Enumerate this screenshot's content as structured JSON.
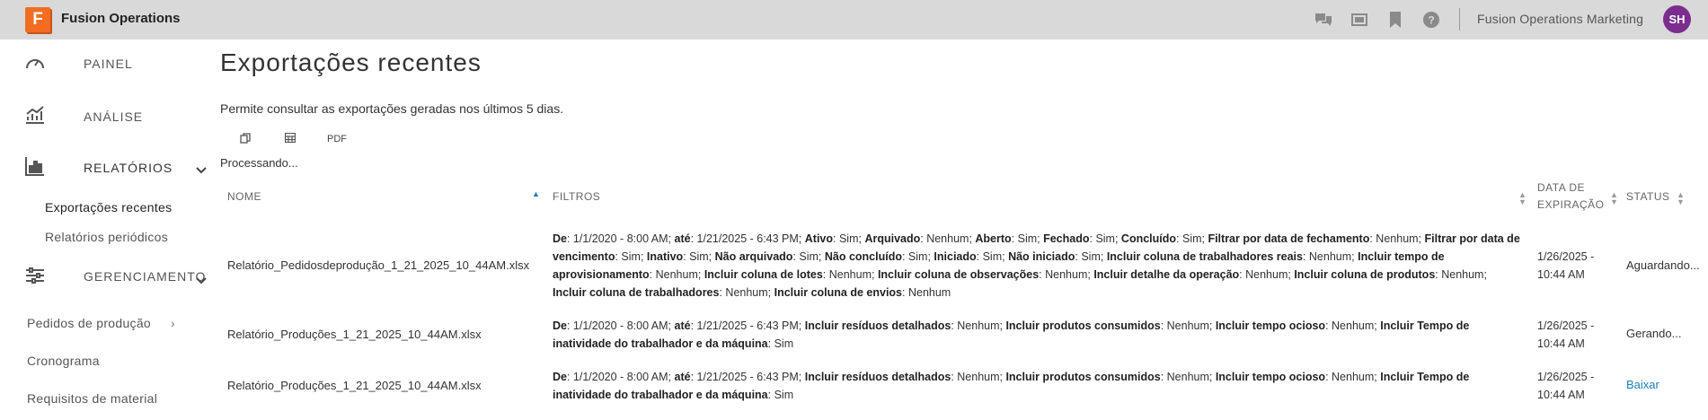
{
  "app": {
    "logo_letter": "F",
    "title": "Fusion Operations",
    "org": "Fusion Operations Marketing",
    "avatar_initials": "SH"
  },
  "topbar_icons": [
    "chat-icon",
    "display-icon",
    "bookmark-icon",
    "help-icon"
  ],
  "sidebar": {
    "items": [
      {
        "label": "PAINEL",
        "icon": "gauge-icon"
      },
      {
        "label": "ANÁLISE",
        "icon": "chart-icon"
      },
      {
        "label": "RELATÓRIOS",
        "icon": "bar-chart-icon"
      },
      {
        "label": "GERENCIAMENTO",
        "icon": "sliders-icon"
      }
    ],
    "sub_items": [
      "Exportações recentes",
      "Relatórios periódicos"
    ],
    "plain_items": [
      "Pedidos de produção",
      "Cronograma",
      "Requisitos de material"
    ]
  },
  "main": {
    "title": "Exportações recentes",
    "description": "Permite consultar as exportações geradas nos últimos 5 dias.",
    "export_buttons": {
      "pdf": "PDF"
    },
    "processing": "Processando..."
  },
  "table": {
    "headers": {
      "name": "NOME",
      "filters": "FILTROS",
      "expiry_line1": "DATA DE",
      "expiry_line2": "EXPIRAÇÃO",
      "status": "STATUS"
    },
    "rows": [
      {
        "name": "Relatório_Pedidosdeprodução_1_21_2025_10_44AM.xlsx",
        "filters": [
          [
            "De",
            "1/1/2020 - 8:00 AM"
          ],
          [
            "até",
            "1/21/2025 - 6:43 PM"
          ],
          [
            "Ativo",
            "Sim"
          ],
          [
            "Arquivado",
            "Nenhum"
          ],
          [
            "Aberto",
            "Sim"
          ],
          [
            "Fechado",
            "Sim"
          ],
          [
            "Concluído",
            "Sim"
          ],
          [
            "Filtrar por data de fechamento",
            "Nenhum"
          ],
          [
            "Filtrar por data de vencimento",
            "Sim"
          ],
          [
            "Inativo",
            "Sim"
          ],
          [
            "Não arquivado",
            "Sim"
          ],
          [
            "Não concluído",
            "Sim"
          ],
          [
            "Iniciado",
            "Sim"
          ],
          [
            "Não iniciado",
            "Sim"
          ],
          [
            "Incluir coluna de trabalhadores reais",
            "Nenhum"
          ],
          [
            "Incluir tempo de aprovisionamento",
            "Nenhum"
          ],
          [
            "Incluir coluna de lotes",
            "Nenhum"
          ],
          [
            "Incluir coluna de observações",
            "Nenhum"
          ],
          [
            "Incluir detalhe da operação",
            "Nenhum"
          ],
          [
            "Incluir coluna de produtos",
            "Nenhum"
          ],
          [
            "Incluir coluna de trabalhadores",
            "Nenhum"
          ],
          [
            "Incluir coluna de envios",
            "Nenhum"
          ]
        ],
        "expiry_date": "1/26/2025 -",
        "expiry_time": "10:44 AM",
        "status": "Aguardando..."
      },
      {
        "name": "Relatório_Produções_1_21_2025_10_44AM.xlsx",
        "filters": [
          [
            "De",
            "1/1/2020 - 8:00 AM"
          ],
          [
            "até",
            "1/21/2025 - 6:43 PM"
          ],
          [
            "Incluir resíduos detalhados",
            "Nenhum"
          ],
          [
            "Incluir produtos consumidos",
            "Nenhum"
          ],
          [
            "Incluir tempo ocioso",
            "Nenhum"
          ],
          [
            "Incluir Tempo de inatividade do trabalhador e da máquina",
            "Sim"
          ]
        ],
        "expiry_date": "1/26/2025 -",
        "expiry_time": "10:44 AM",
        "status": "Gerando..."
      },
      {
        "name": "Relatório_Produções_1_21_2025_10_44AM.xlsx",
        "filters": [
          [
            "De",
            "1/1/2020 - 8:00 AM"
          ],
          [
            "até",
            "1/21/2025 - 6:43 PM"
          ],
          [
            "Incluir resíduos detalhados",
            "Nenhum"
          ],
          [
            "Incluir produtos consumidos",
            "Nenhum"
          ],
          [
            "Incluir tempo ocioso",
            "Nenhum"
          ],
          [
            "Incluir Tempo de inatividade do trabalhador e da máquina",
            "Sim"
          ]
        ],
        "expiry_date": "1/26/2025 -",
        "expiry_time": "10:44 AM",
        "status": "Baixar"
      }
    ]
  }
}
